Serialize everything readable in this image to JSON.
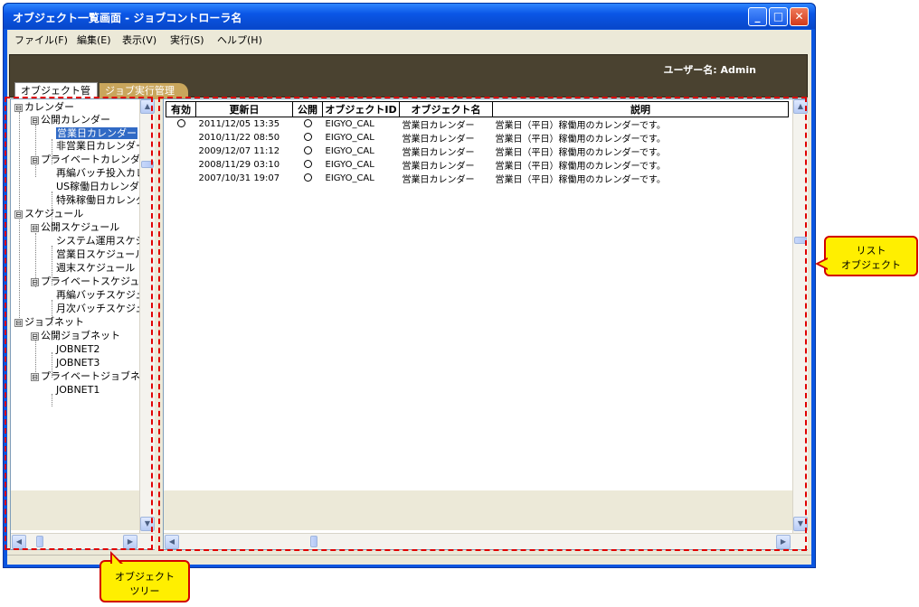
{
  "window": {
    "title": "オブジェクト一覧画面 - ジョブコントローラ名",
    "buttons": {
      "minimize": "_",
      "maximize": "□",
      "close": "✕"
    }
  },
  "menu": [
    "ファイル(F)",
    "編集(E)",
    "表示(V)",
    "実行(S)",
    "ヘルプ(H)"
  ],
  "header": {
    "username": "ユーザー名: Admin"
  },
  "tabs": [
    {
      "label": "オブジェクト管理",
      "active": true
    },
    {
      "label": "ジョブ実行管理",
      "active": false
    }
  ],
  "tree": {
    "nodes": [
      {
        "label": "カレンダー",
        "expander": "⊟"
      },
      {
        "label": "公開カレンダー",
        "expander": "⊟"
      },
      {
        "label": "営業日カレンダー",
        "selected": true
      },
      {
        "label": "非営業日カレンダー"
      },
      {
        "label": "プライベートカレンダー",
        "expander": "⊟"
      },
      {
        "label": "再編バッチ投入カレンダー"
      },
      {
        "label": "US稼働日カレンダー"
      },
      {
        "label": "特殊稼働日カレンダー"
      },
      {
        "label": "スケジュール",
        "expander": "⊟"
      },
      {
        "label": "公開スケジュール",
        "expander": "⊟"
      },
      {
        "label": "システム運用スケジュール"
      },
      {
        "label": "営業日スケジュール"
      },
      {
        "label": "週末スケジュール"
      },
      {
        "label": "プライベートスケジュール",
        "expander": "⊟"
      },
      {
        "label": "再編バッチスケジュール"
      },
      {
        "label": "月次バッチスケジュール"
      },
      {
        "label": "ジョブネット",
        "expander": "⊟"
      },
      {
        "label": "公開ジョブネット",
        "expander": "⊟"
      },
      {
        "label": "JOBNET2"
      },
      {
        "label": "JOBNET3"
      },
      {
        "label": "プライベートジョブネット",
        "expander": "⊟"
      },
      {
        "label": "JOBNET1"
      }
    ]
  },
  "list": {
    "columns": [
      "有効",
      "更新日",
      "公開",
      "オブジェクトID",
      "オブジェクト名",
      "説明"
    ],
    "rows": [
      {
        "updated": "2011/12/05 13:35",
        "id": "EIGYO_CAL",
        "name": "営業日カレンダー",
        "desc": "営業日（平日）稼働用のカレンダーです。"
      },
      {
        "updated": "2010/11/22 08:50",
        "id": "EIGYO_CAL",
        "name": "営業日カレンダー",
        "desc": "営業日（平日）稼働用のカレンダーです。"
      },
      {
        "updated": "2009/12/07 11:12",
        "id": "EIGYO_CAL",
        "name": "営業日カレンダー",
        "desc": "営業日（平日）稼働用のカレンダーです。"
      },
      {
        "updated": "2008/11/29 03:10",
        "id": "EIGYO_CAL",
        "name": "営業日カレンダー",
        "desc": "営業日（平日）稼働用のカレンダーです。"
      },
      {
        "updated": "2007/10/31 19:07",
        "id": "EIGYO_CAL",
        "name": "営業日カレンダー",
        "desc": "営業日（平日）稼働用のカレンダーです。"
      }
    ]
  },
  "annotations": {
    "list_callout": [
      "リスト",
      "オブジェクト"
    ],
    "tree_callout": [
      "オブジェクト",
      "ツリー"
    ]
  },
  "icons": [
    "scroll-up-icon",
    "scroll-down-icon",
    "scroll-left-icon",
    "scroll-right-icon",
    "tree-expander-icon",
    "radio-circle-icon"
  ],
  "colors": {
    "titlebar": "#0a56e6",
    "header_band": "#4a4230",
    "selected": "#316ac5",
    "annotation_border": "#e00000",
    "callout_fill": "#ffef00"
  }
}
